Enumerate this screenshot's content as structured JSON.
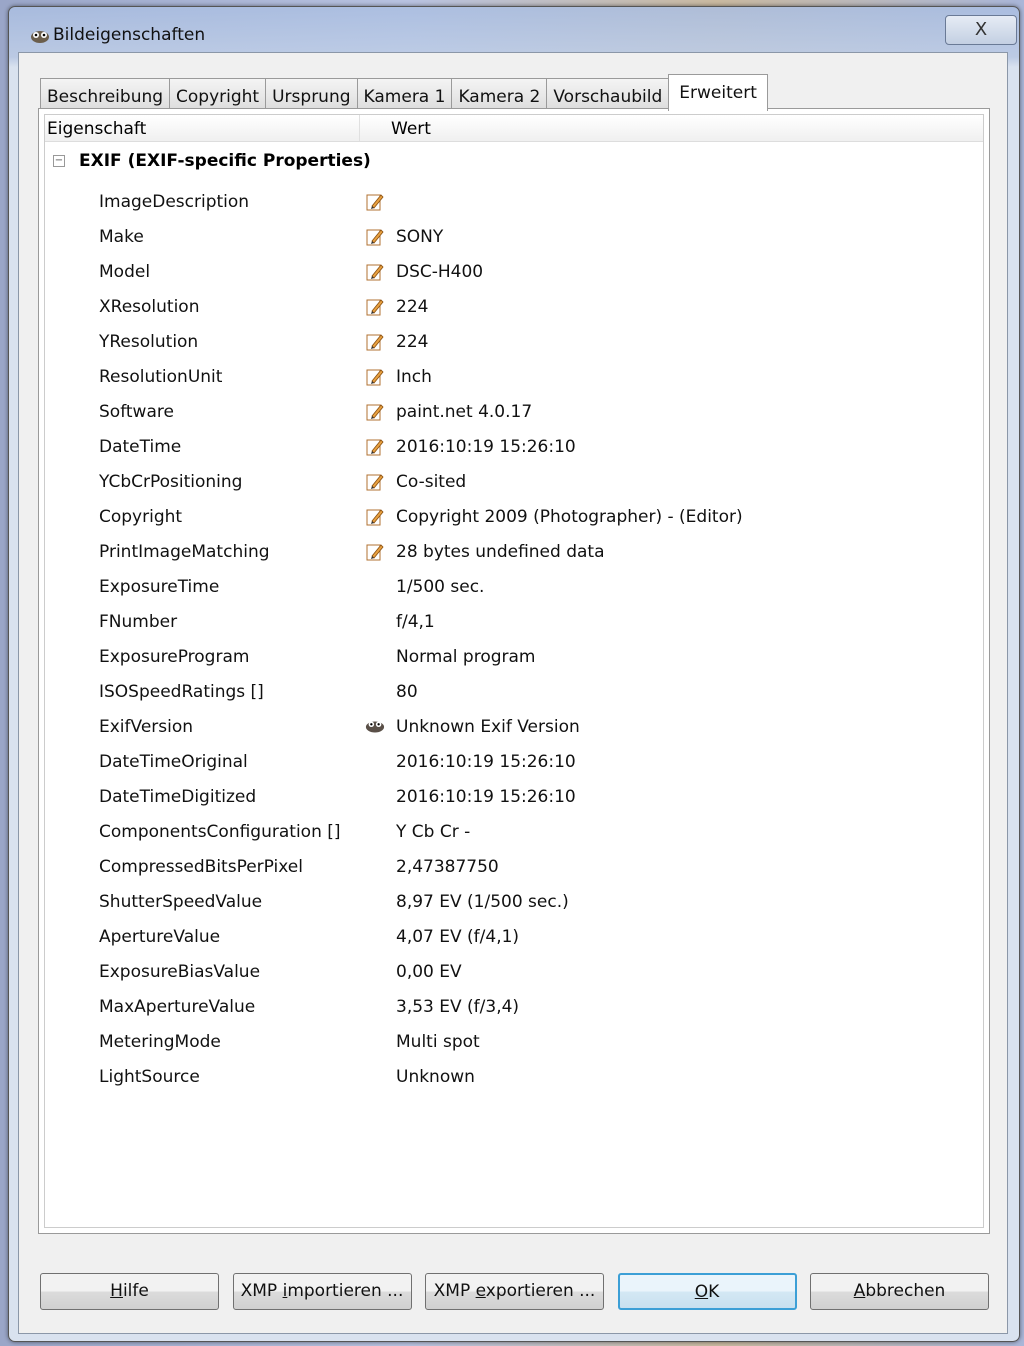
{
  "window": {
    "title": "Bildeigenschaften",
    "close_label": "X"
  },
  "tabs": [
    {
      "label": "Beschreibung"
    },
    {
      "label": "Copyright"
    },
    {
      "label": "Ursprung"
    },
    {
      "label": "Kamera 1"
    },
    {
      "label": "Kamera 2"
    },
    {
      "label": "Vorschaubild"
    },
    {
      "label": "Erweitert",
      "active": true
    }
  ],
  "table": {
    "col_property": "Eigenschaft",
    "col_value": "Wert",
    "group": "EXIF (EXIF-specific Properties)",
    "expander": "−",
    "rows": [
      {
        "p": "ImageDescription",
        "v": "",
        "icon": "edit"
      },
      {
        "p": "Make",
        "v": "SONY",
        "icon": "edit"
      },
      {
        "p": "Model",
        "v": "DSC-H400",
        "icon": "edit"
      },
      {
        "p": "XResolution",
        "v": "224",
        "icon": "edit"
      },
      {
        "p": "YResolution",
        "v": "224",
        "icon": "edit"
      },
      {
        "p": "ResolutionUnit",
        "v": "Inch",
        "icon": "edit"
      },
      {
        "p": "Software",
        "v": "paint.net 4.0.17",
        "icon": "edit"
      },
      {
        "p": "DateTime",
        "v": "2016:10:19 15:26:10",
        "icon": "edit"
      },
      {
        "p": "YCbCrPositioning",
        "v": "Co-sited",
        "icon": "edit"
      },
      {
        "p": "Copyright",
        "v": "Copyright 2009 (Photographer) -  (Editor)",
        "icon": "edit"
      },
      {
        "p": "PrintImageMatching",
        "v": "28 bytes undefined data",
        "icon": "edit"
      },
      {
        "p": "ExposureTime",
        "v": "1/500 sec.",
        "icon": ""
      },
      {
        "p": "FNumber",
        "v": "f/4,1",
        "icon": ""
      },
      {
        "p": "ExposureProgram",
        "v": "Normal program",
        "icon": ""
      },
      {
        "p": "ISOSpeedRatings []",
        "v": "80",
        "icon": ""
      },
      {
        "p": "ExifVersion",
        "v": "Unknown Exif Version",
        "icon": "warning-gimp"
      },
      {
        "p": "DateTimeOriginal",
        "v": "2016:10:19 15:26:10",
        "icon": ""
      },
      {
        "p": "DateTimeDigitized",
        "v": "2016:10:19 15:26:10",
        "icon": ""
      },
      {
        "p": "ComponentsConfiguration []",
        "v": "Y Cb Cr -",
        "icon": ""
      },
      {
        "p": "CompressedBitsPerPixel",
        "v": "2,47387750",
        "icon": ""
      },
      {
        "p": "ShutterSpeedValue",
        "v": "8,97 EV (1/500 sec.)",
        "icon": ""
      },
      {
        "p": "ApertureValue",
        "v": "4,07 EV (f/4,1)",
        "icon": ""
      },
      {
        "p": "ExposureBiasValue",
        "v": "0,00 EV",
        "icon": ""
      },
      {
        "p": "MaxApertureValue",
        "v": "3,53 EV (f/3,4)",
        "icon": ""
      },
      {
        "p": "MeteringMode",
        "v": "Multi spot",
        "icon": ""
      },
      {
        "p": "LightSource",
        "v": "Unknown",
        "icon": ""
      }
    ]
  },
  "buttons": [
    {
      "name": "help-button",
      "pre": "",
      "key": "H",
      "post": "ilfe"
    },
    {
      "name": "xmp-import-button",
      "pre": "XMP ",
      "key": "i",
      "post": "mportieren ..."
    },
    {
      "name": "xmp-export-button",
      "pre": "XMP ",
      "key": "e",
      "post": "xportieren ..."
    },
    {
      "name": "ok-button",
      "pre": "",
      "key": "O",
      "post": "K",
      "default": true
    },
    {
      "name": "cancel-button",
      "pre": "",
      "key": "A",
      "post": "bbrechen"
    }
  ],
  "colors": {
    "accent": "#3c9fd6"
  }
}
